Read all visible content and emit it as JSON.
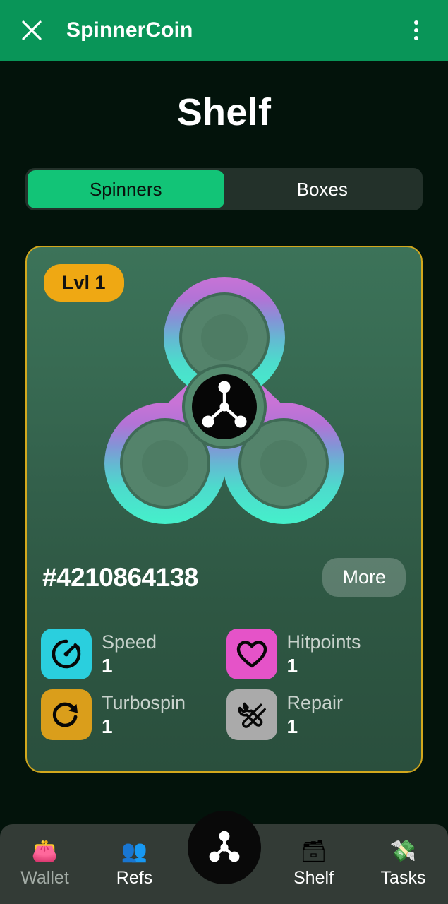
{
  "appbar": {
    "close_icon": "close-icon",
    "title": "SpinnerCoin",
    "menu_icon": "kebab-menu-icon"
  },
  "page": {
    "title": "Shelf"
  },
  "tabs": [
    {
      "label": "Spinners",
      "active": true
    },
    {
      "label": "Boxes",
      "active": false
    }
  ],
  "card": {
    "level_badge": "Lvl 1",
    "spinner_id": "#4210864138",
    "more_label": "More",
    "spinner_art": {
      "gradient_top": "#BB6FD0",
      "gradient_mid": "#6FA8D4",
      "gradient_bottom": "#45EDC8",
      "hub_icon": "spinner-logo-icon",
      "hub_color": "#050505"
    },
    "border_color": "#D3A81D",
    "stats": [
      {
        "label": "Speed",
        "value": "1",
        "icon": "speedometer-icon",
        "color": "#2ACFDE"
      },
      {
        "label": "Hitpoints",
        "value": "1",
        "icon": "heart-icon",
        "color": "#E553C8"
      },
      {
        "label": "Turbospin",
        "value": "1",
        "icon": "rotate-icon",
        "color": "#DA9E1B"
      },
      {
        "label": "Repair",
        "value": "1",
        "icon": "tools-icon",
        "color": "#AAAAAA"
      }
    ]
  },
  "bottom_nav": {
    "items": [
      {
        "label": "Wallet",
        "emoji": "👛",
        "icon": "purse-icon",
        "active": false
      },
      {
        "label": "Refs",
        "emoji": "👥",
        "icon": "people-icon",
        "active": true
      },
      {
        "label": "Shelf",
        "emoji": "🗃",
        "icon": "card-box-icon",
        "active": true
      },
      {
        "label": "Tasks",
        "emoji": "💸",
        "icon": "money-wings-icon",
        "active": true
      }
    ],
    "fab_icon": "spinner-logo-icon"
  },
  "colors": {
    "accent_green": "#12C477",
    "appbar_green": "#099558",
    "badge_amber": "#EFA813",
    "card_border": "#D3A81D"
  }
}
